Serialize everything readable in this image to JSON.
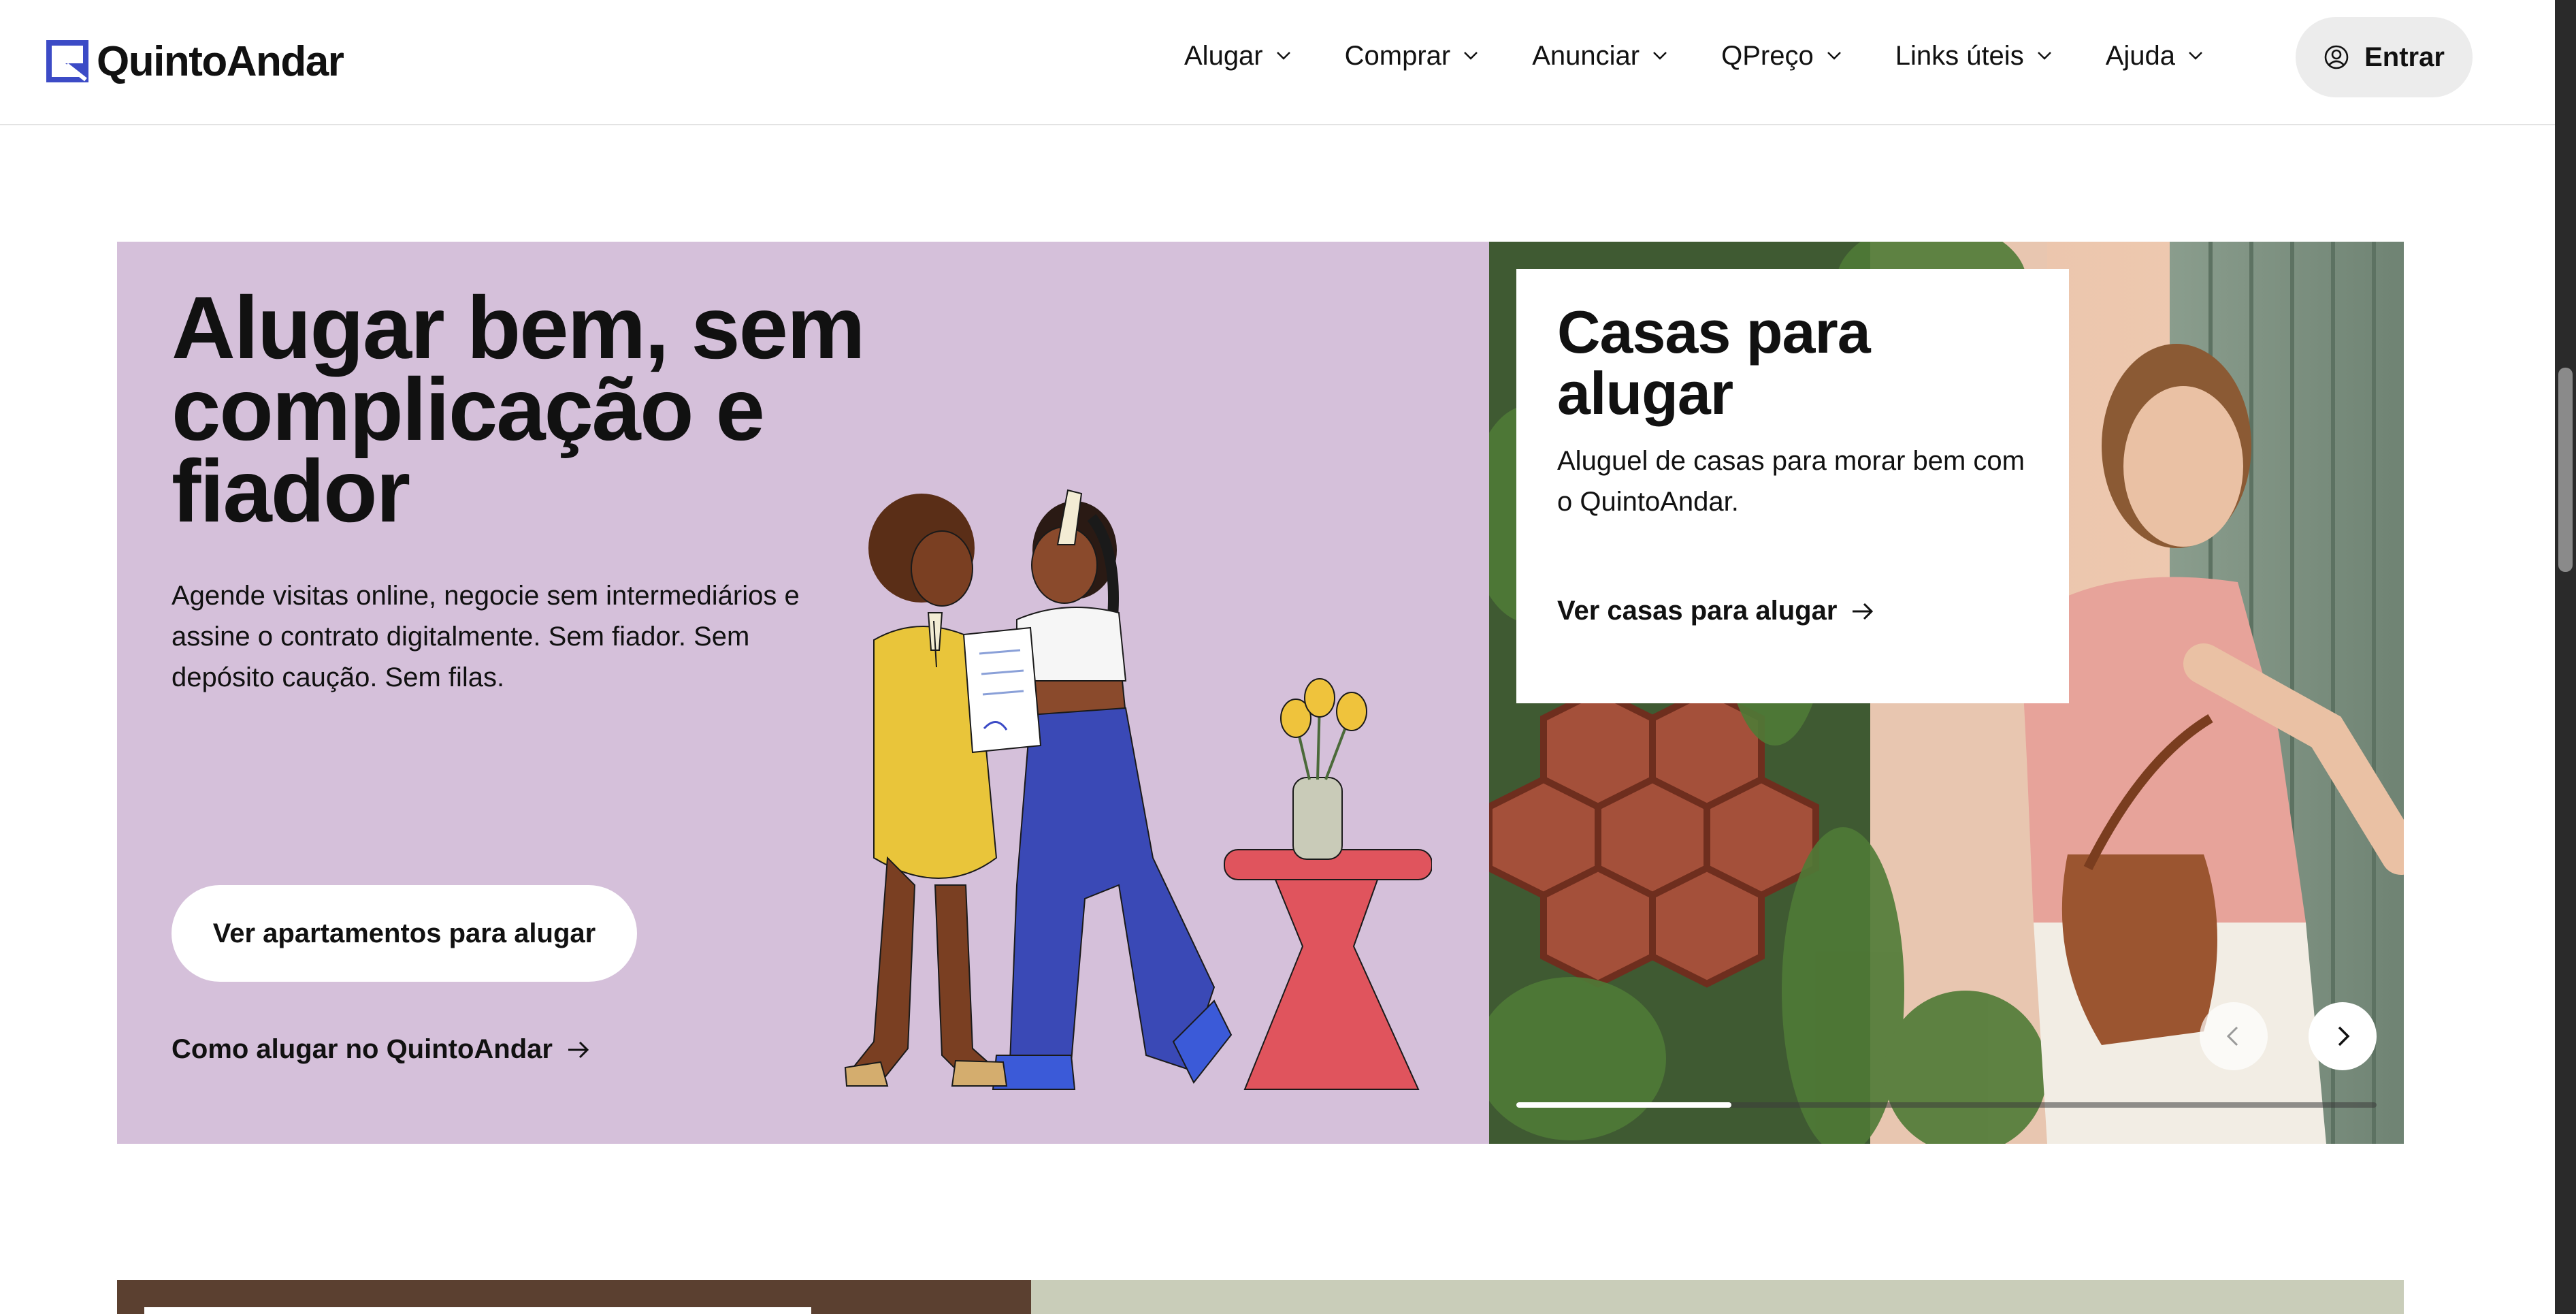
{
  "header": {
    "logo_text": "QuintoAndar",
    "nav": [
      {
        "label": "Alugar"
      },
      {
        "label": "Comprar"
      },
      {
        "label": "Anunciar"
      },
      {
        "label": "QPreço"
      },
      {
        "label": "Links úteis"
      },
      {
        "label": "Ajuda"
      }
    ],
    "login_label": "Entrar"
  },
  "hero": {
    "title": "Alugar bem, sem complicação e fiador",
    "description": "Agende visitas online, negocie sem intermediários e assine o contrato digitalmente. Sem fiador. Sem depósito caução. Sem filas.",
    "primary_button": "Ver apartamentos para alugar",
    "secondary_link": "Como alugar no QuintoAndar"
  },
  "carousel": {
    "card_title": "Casas para alugar",
    "card_text": "Aluguel de casas para morar bem com o QuintoAndar.",
    "card_link": "Ver casas para alugar",
    "progress": 0.25
  },
  "colors": {
    "brand": "#3c4bc6",
    "hero_bg": "#d5c0da",
    "button_bg": "#ffffff",
    "login_bg": "#ececec"
  }
}
